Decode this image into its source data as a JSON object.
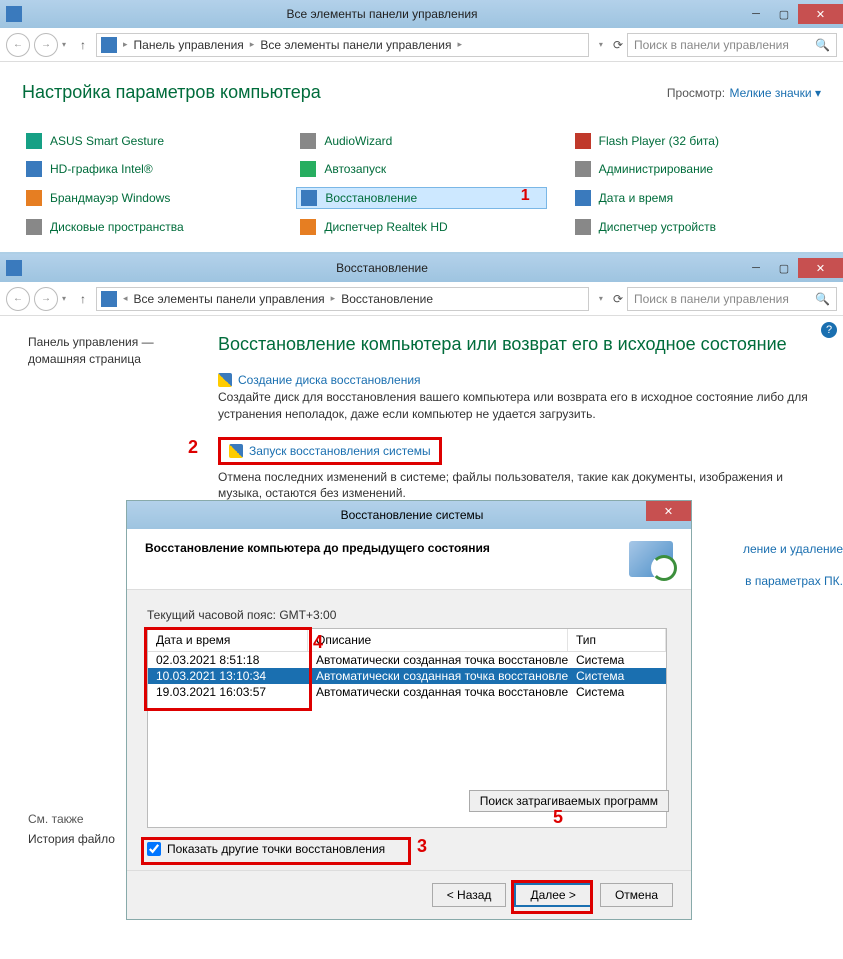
{
  "window1": {
    "title": "Все элементы панели управления",
    "breadcrumb": [
      "Панель управления",
      "Все элементы панели управления"
    ],
    "search_placeholder": "Поиск в панели управления",
    "heading": "Настройка параметров компьютера",
    "view_label": "Просмотр:",
    "view_value": "Мелкие значки",
    "items": [
      {
        "label": "ASUS Smart Gesture",
        "icon": "i-teal"
      },
      {
        "label": "AudioWizard",
        "icon": "i-gray"
      },
      {
        "label": "Flash Player (32 бита)",
        "icon": "i-red"
      },
      {
        "label": "HD-графика Intel®",
        "icon": "i-blue"
      },
      {
        "label": "Автозапуск",
        "icon": "i-green"
      },
      {
        "label": "Администрирование",
        "icon": "i-gray"
      },
      {
        "label": "Брандмауэр Windows",
        "icon": "i-orange"
      },
      {
        "label": "Восстановление",
        "icon": "i-blue",
        "selected": true,
        "ann": "1"
      },
      {
        "label": "Дата и время",
        "icon": "i-blue"
      },
      {
        "label": "Дисковые пространства",
        "icon": "i-gray"
      },
      {
        "label": "Диспетчер Realtek HD",
        "icon": "i-orange"
      },
      {
        "label": "Диспетчер устройств",
        "icon": "i-gray"
      }
    ]
  },
  "window2": {
    "title": "Восстановление",
    "breadcrumb": [
      "Все элементы панели управления",
      "Восстановление"
    ],
    "search_placeholder": "Поиск в панели управления",
    "sidebar_text": "Панель управления — домашняя страница",
    "heading": "Восстановление компьютера или возврат его в исходное состояние",
    "link1": "Создание диска восстановления",
    "desc1": "Создайте диск для восстановления вашего компьютера или возврата его в исходное состояние либо для устранения неполадок, даже если компьютер не удается загрузить.",
    "link2": "Запуск восстановления системы",
    "desc2": "Отмена последних изменений в системе; файлы пользователя, такие как документы, изображения и музыка, остаются без изменений.",
    "hint_right1": "ление и удаление",
    "hint_right2": "в параметрах ПК.",
    "ann": "2",
    "seealso": "См. также",
    "seealso_link": "История файло"
  },
  "dialog": {
    "title": "Восстановление системы",
    "banner_text": "Восстановление компьютера до предыдущего состояния",
    "tz": "Текущий часовой пояс: GMT+3:00",
    "columns": [
      "Дата и время",
      "Описание",
      "Тип"
    ],
    "rows": [
      {
        "date": "02.03.2021 8:51:18",
        "desc": "Автоматически созданная точка восстановле…",
        "type": "Система"
      },
      {
        "date": "10.03.2021 13:10:34",
        "desc": "Автоматически созданная точка восстановле…",
        "type": "Система",
        "selected": true
      },
      {
        "date": "19.03.2021 16:03:57",
        "desc": "Автоматически созданная точка восстановле…",
        "type": "Система"
      }
    ],
    "checkbox_label": "Показать другие точки восстановления",
    "affected_btn": "Поиск затрагиваемых программ",
    "btn_back": "< Назад",
    "btn_next": "Далее >",
    "btn_cancel": "Отмена",
    "ann3": "3",
    "ann4": "4",
    "ann5": "5"
  }
}
